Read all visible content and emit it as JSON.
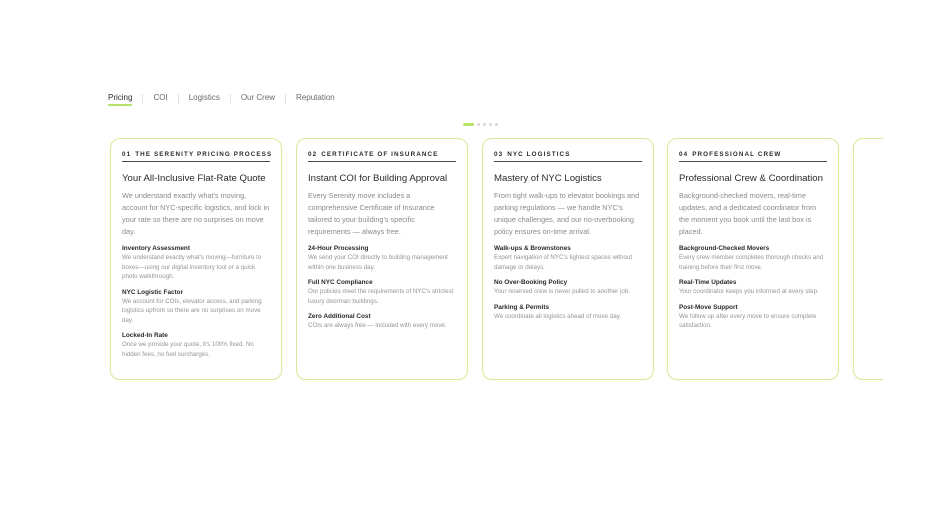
{
  "tabs": [
    {
      "label": "Pricing",
      "active": true
    },
    {
      "label": "COI",
      "active": false
    },
    {
      "label": "Logistics",
      "active": false
    },
    {
      "label": "Our Crew",
      "active": false
    },
    {
      "label": "Reputation",
      "active": false
    }
  ],
  "carousel": {
    "dot_count": 5,
    "active_index": 0,
    "accent": "#b9e26a"
  },
  "cards": [
    {
      "num": "01",
      "heading": "THE SERENITY PRICING PROCESS",
      "title": "Your All-Inclusive Flat-Rate Quote",
      "desc": "We understand exactly what's moving, account for NYC-specific logistics, and lock in your rate so there are no surprises on move day.",
      "features": [
        {
          "title": "Inventory Assessment",
          "desc": "We understand exactly what's moving—furniture to boxes—using our digital inventory tool or a quick photo walkthrough."
        },
        {
          "title": "NYC Logistic Factor",
          "desc": "We account for COIs, elevator access, and parking logistics upfront so there are no surprises on move day."
        },
        {
          "title": "Locked-In Rate",
          "desc": "Once we provide your quote, it's 100% fixed. No hidden fees, no fuel surcharges."
        }
      ]
    },
    {
      "num": "02",
      "heading": "CERTIFICATE OF INSURANCE",
      "title": "Instant COI for Building Approval",
      "desc": "Every Serenity move includes a comprehensive Certificate of Insurance tailored to your building's specific requirements — always free.",
      "features": [
        {
          "title": "24-Hour Processing",
          "desc": "We send your COI directly to building management within one business day."
        },
        {
          "title": "Full NYC Compliance",
          "desc": "Our policies meet the requirements of NYC's strictest luxury doorman buildings."
        },
        {
          "title": "Zero Additional Cost",
          "desc": "COIs are always free — included with every move."
        }
      ]
    },
    {
      "num": "03",
      "heading": "NYC LOGISTICS",
      "title": "Mastery of NYC Logistics",
      "desc": "From tight walk-ups to elevator bookings and parking regulations — we handle NYC's unique challenges, and our no-overbooking policy ensures on-time arrival.",
      "features": [
        {
          "title": "Walk-ups & Brownstones",
          "desc": "Expert navigation of NYC's tightest spaces without damage or delays."
        },
        {
          "title": "No Over-Booking Policy",
          "desc": "Your reserved crew is never pulled to another job."
        },
        {
          "title": "Parking & Permits",
          "desc": "We coordinate all logistics ahead of move day."
        }
      ]
    },
    {
      "num": "04",
      "heading": "PROFESSIONAL CREW",
      "title": "Professional Crew & Coordination",
      "desc": "Background-checked movers, real-time updates, and a dedicated coordinator from the moment you book until the last box is placed.",
      "features": [
        {
          "title": "Background-Checked Movers",
          "desc": "Every crew member completes thorough checks and training before their first move."
        },
        {
          "title": "Real-Time Updates",
          "desc": "Your coordinator keeps you informed at every step."
        },
        {
          "title": "Post-Move Support",
          "desc": "We follow up after every move to ensure complete satisfaction."
        }
      ]
    }
  ]
}
